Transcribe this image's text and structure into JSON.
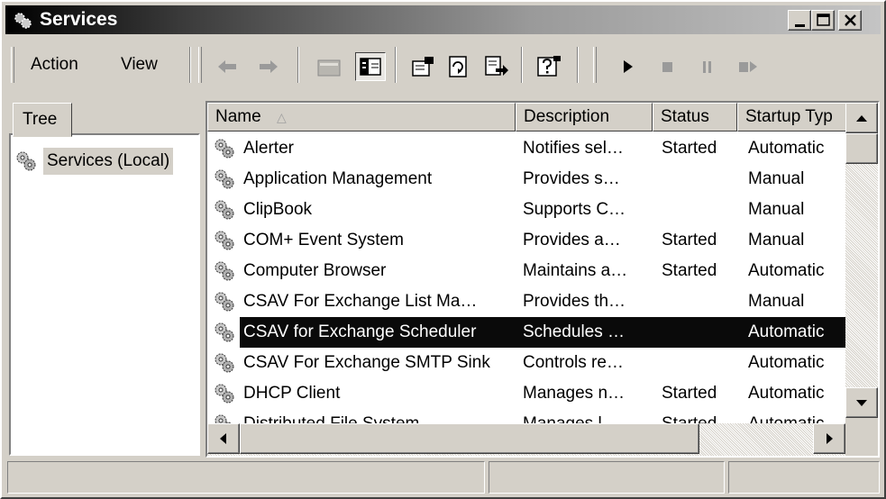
{
  "window": {
    "title": "Services"
  },
  "toolbar": {
    "menu_action": "Action",
    "menu_view": "View"
  },
  "tree": {
    "tab_label": "Tree",
    "root_label": "Services (Local)"
  },
  "list": {
    "columns": [
      "Name",
      "Description",
      "Status",
      "Startup Typ"
    ],
    "rows": [
      {
        "name": "Alerter",
        "description": "Notifies sel…",
        "status": "Started",
        "startup": "Automatic"
      },
      {
        "name": "Application Management",
        "description": "Provides s…",
        "status": "",
        "startup": "Manual"
      },
      {
        "name": "ClipBook",
        "description": "Supports C…",
        "status": "",
        "startup": "Manual"
      },
      {
        "name": "COM+ Event System",
        "description": "Provides a…",
        "status": "Started",
        "startup": "Manual"
      },
      {
        "name": "Computer Browser",
        "description": "Maintains a…",
        "status": "Started",
        "startup": "Automatic"
      },
      {
        "name": "CSAV For Exchange List Ma…",
        "description": "Provides th…",
        "status": "",
        "startup": "Manual"
      },
      {
        "name": "CSAV for Exchange Scheduler",
        "description": "Schedules …",
        "status": "",
        "startup": "Automatic",
        "selected": true
      },
      {
        "name": "CSAV For Exchange SMTP Sink",
        "description": "Controls re…",
        "status": "",
        "startup": "Automatic"
      },
      {
        "name": "DHCP Client",
        "description": "Manages n…",
        "status": "Started",
        "startup": "Automatic"
      },
      {
        "name": "Distributed File System",
        "description": "Manages l…",
        "status": "Started",
        "startup": "Automatic"
      }
    ]
  },
  "colors": {
    "selection": "#0a0a0a",
    "titlebar_start": "#000000",
    "face": "#d4d0c8"
  },
  "icons": [
    "services-icon",
    "minimize-icon",
    "maximize-icon",
    "close-icon",
    "back-icon",
    "forward-icon",
    "up-folder-icon",
    "show-hide-tree-icon",
    "properties-icon",
    "refresh-icon",
    "export-list-icon",
    "help-icon",
    "start-service-icon",
    "stop-service-icon",
    "pause-service-icon",
    "restart-service-icon",
    "gear-icon"
  ]
}
